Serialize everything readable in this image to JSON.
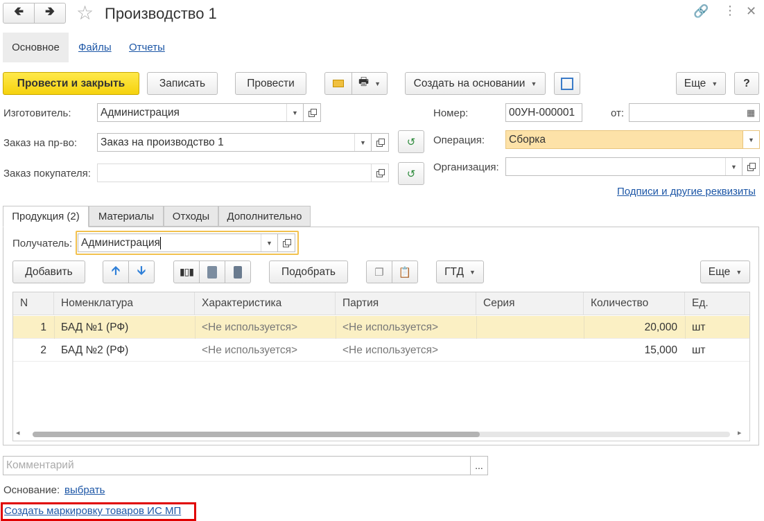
{
  "window": {
    "title": "Производство 1"
  },
  "nav_tabs": [
    "Основное",
    "Файлы",
    "Отчеты"
  ],
  "toolbar": {
    "post_close": "Провести и закрыть",
    "save": "Записать",
    "post": "Провести",
    "create_based": "Создать на основании",
    "more": "Еще",
    "help": "?"
  },
  "form": {
    "manufacturer_label": "Изготовитель:",
    "manufacturer_value": "Администрация",
    "prod_order_label": "Заказ на пр-во:",
    "prod_order_value": "Заказ на производство 1",
    "customer_order_label": "Заказ покупателя:",
    "customer_order_value": "",
    "number_label": "Номер:",
    "number_value": "00УН-000001",
    "from_label": "от:",
    "from_value": "",
    "operation_label": "Операция:",
    "operation_value": "Сборка",
    "org_label": "Организация:",
    "org_value": "",
    "signatures_link": "Подписи и другие реквизиты"
  },
  "section_tabs": [
    "Продукция (2)",
    "Материалы",
    "Отходы",
    "Дополнительно"
  ],
  "recipient": {
    "label": "Получатель:",
    "value": "Администрация"
  },
  "table_toolbar": {
    "add": "Добавить",
    "pick": "Подобрать",
    "gtd": "ГТД",
    "more": "Еще"
  },
  "table": {
    "columns": [
      "N",
      "Номенклатура",
      "Характеристика",
      "Партия",
      "Серия",
      "Количество",
      "Ед."
    ],
    "rows": [
      {
        "n": "1",
        "item": "БАД №1 (РФ)",
        "char": "<Не используется>",
        "batch": "<Не используется>",
        "series": "",
        "qty": "20,000",
        "unit": "шт"
      },
      {
        "n": "2",
        "item": "БАД №2 (РФ)",
        "char": "<Не используется>",
        "batch": "<Не используется>",
        "series": "",
        "qty": "15,000",
        "unit": "шт"
      }
    ],
    "selected_row": 0
  },
  "comment": {
    "placeholder": "Комментарий",
    "button": "..."
  },
  "basis": {
    "label": "Основание:",
    "link": "выбрать"
  },
  "marking_link": "Создать маркировку товаров ИС МП",
  "colors": {
    "primary": "#f5d20e",
    "highlight_row": "#fbf0c4",
    "highlight_field": "#fde2a8",
    "link": "#1c56a6",
    "marking_box": "#e00000",
    "recipient_border": "#f2c14e"
  }
}
